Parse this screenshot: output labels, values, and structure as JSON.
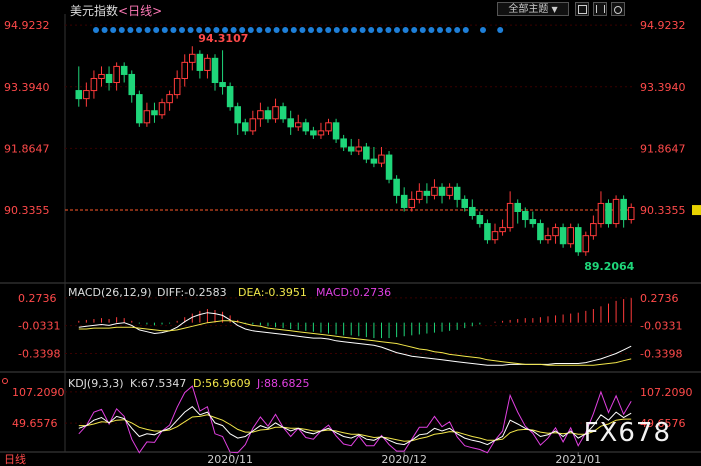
{
  "header": {
    "symbol": "美元指数",
    "period": "<日线>",
    "theme_button": "全部主题",
    "theme_arrow": "▼"
  },
  "colors": {
    "up": "#ff3b3b",
    "down": "#1fd67a",
    "price_axis": "#ff4a4a",
    "grid": "#3a0000",
    "diff_line": "#ffffff",
    "dea_line": "#f2e64a",
    "macd_label": "#e040e0",
    "kdj_k": "#ffffff",
    "kdj_d": "#f2e64a",
    "kdj_j": "#e040e0",
    "dots": "#1e7fd8"
  },
  "chart_data": {
    "type": "candlestick",
    "price_axis": {
      "ticks": [
        "94.9232",
        "93.3940",
        "91.8647",
        "90.3355"
      ],
      "values": [
        94.9232,
        93.394,
        91.8647,
        90.3355
      ]
    },
    "ylim": [
      88.6,
      95.2
    ],
    "current_price": 90.3355,
    "high_annotation": "94.3107",
    "low_annotation": "89.2064",
    "x_labels": [
      "2020/11",
      "2020/12",
      "2021/01"
    ],
    "candles": [
      [
        93.3,
        93.1,
        93.9,
        92.9
      ],
      [
        93.1,
        93.3,
        93.5,
        92.9
      ],
      [
        93.3,
        93.6,
        93.8,
        93.1
      ],
      [
        93.6,
        93.7,
        93.9,
        93.4
      ],
      [
        93.7,
        93.5,
        93.9,
        93.3
      ],
      [
        93.5,
        93.9,
        94.0,
        93.3
      ],
      [
        93.9,
        93.7,
        94.0,
        93.5
      ],
      [
        93.7,
        93.2,
        93.8,
        93.0
      ],
      [
        93.2,
        92.5,
        93.3,
        92.4
      ],
      [
        92.5,
        92.8,
        93.0,
        92.4
      ],
      [
        92.8,
        92.7,
        93.0,
        92.5
      ],
      [
        92.7,
        93.0,
        93.1,
        92.6
      ],
      [
        93.0,
        93.2,
        93.3,
        92.8
      ],
      [
        93.2,
        93.6,
        93.8,
        93.1
      ],
      [
        93.6,
        94.0,
        94.2,
        93.4
      ],
      [
        94.0,
        94.2,
        94.4,
        93.8
      ],
      [
        94.2,
        93.8,
        94.3,
        93.6
      ],
      [
        93.8,
        94.1,
        94.2,
        93.6
      ],
      [
        94.1,
        93.5,
        94.2,
        93.3
      ],
      [
        93.5,
        93.4,
        94.3,
        93.2
      ],
      [
        93.4,
        92.9,
        93.5,
        92.8
      ],
      [
        92.9,
        92.5,
        93.0,
        92.2
      ],
      [
        92.5,
        92.3,
        92.6,
        92.2
      ],
      [
        92.3,
        92.6,
        92.8,
        92.2
      ],
      [
        92.6,
        92.8,
        93.0,
        92.4
      ],
      [
        92.8,
        92.6,
        92.9,
        92.5
      ],
      [
        92.6,
        92.9,
        93.1,
        92.5
      ],
      [
        92.9,
        92.6,
        93.0,
        92.5
      ],
      [
        92.6,
        92.4,
        92.8,
        92.2
      ],
      [
        92.4,
        92.5,
        92.7,
        92.3
      ],
      [
        92.5,
        92.3,
        92.6,
        92.2
      ],
      [
        92.3,
        92.2,
        92.4,
        92.1
      ],
      [
        92.2,
        92.3,
        92.5,
        92.1
      ],
      [
        92.3,
        92.5,
        92.6,
        92.2
      ],
      [
        92.5,
        92.1,
        92.6,
        92.0
      ],
      [
        92.1,
        91.9,
        92.2,
        91.8
      ],
      [
        91.9,
        91.8,
        92.1,
        91.7
      ],
      [
        91.8,
        91.9,
        92.1,
        91.7
      ],
      [
        91.9,
        91.6,
        92.0,
        91.5
      ],
      [
        91.6,
        91.5,
        91.9,
        91.4
      ],
      [
        91.5,
        91.7,
        91.9,
        91.4
      ],
      [
        91.7,
        91.1,
        91.8,
        91.0
      ],
      [
        91.1,
        90.7,
        91.2,
        90.5
      ],
      [
        90.7,
        90.4,
        90.9,
        90.3
      ],
      [
        90.4,
        90.6,
        90.8,
        90.3
      ],
      [
        90.6,
        90.8,
        91.0,
        90.5
      ],
      [
        90.8,
        90.7,
        91.0,
        90.5
      ],
      [
        90.7,
        90.9,
        91.1,
        90.6
      ],
      [
        90.9,
        90.7,
        91.0,
        90.5
      ],
      [
        90.7,
        90.9,
        91.0,
        90.6
      ],
      [
        90.9,
        90.6,
        91.0,
        90.4
      ],
      [
        90.6,
        90.4,
        90.7,
        90.3
      ],
      [
        90.4,
        90.2,
        90.6,
        90.1
      ],
      [
        90.2,
        90.0,
        90.3,
        89.9
      ],
      [
        90.0,
        89.6,
        90.1,
        89.5
      ],
      [
        89.6,
        89.8,
        90.0,
        89.5
      ],
      [
        89.8,
        89.9,
        90.1,
        89.7
      ],
      [
        89.9,
        90.5,
        90.8,
        89.8
      ],
      [
        90.5,
        90.3,
        90.6,
        90.0
      ],
      [
        90.3,
        90.1,
        90.4,
        89.9
      ],
      [
        90.1,
        90.0,
        90.3,
        89.9
      ],
      [
        90.0,
        89.6,
        90.1,
        89.5
      ],
      [
        89.6,
        89.7,
        89.9,
        89.5
      ],
      [
        89.7,
        89.9,
        90.0,
        89.5
      ],
      [
        89.9,
        89.5,
        90.0,
        89.4
      ],
      [
        89.5,
        89.9,
        90.0,
        89.4
      ],
      [
        89.9,
        89.3,
        90.0,
        89.2
      ],
      [
        89.3,
        89.7,
        89.8,
        89.2
      ],
      [
        89.7,
        90.0,
        90.2,
        89.6
      ],
      [
        90.0,
        90.5,
        90.8,
        89.9
      ],
      [
        90.5,
        90.0,
        90.6,
        89.9
      ],
      [
        90.0,
        90.6,
        90.7,
        89.9
      ],
      [
        90.6,
        90.1,
        90.7,
        89.9
      ],
      [
        90.1,
        90.4,
        90.5,
        90.0
      ]
    ],
    "macd": {
      "label": "MACD(26,12,9)",
      "diff_label": "DIFF:-0.2583",
      "dea_label": "DEA:-0.3951",
      "macd_label": "MACD:0.2736",
      "ticks": [
        "0.2736",
        "-0.0331",
        "-0.3398"
      ],
      "ylim": [
        -0.5,
        0.36
      ],
      "histogram": [
        0.02,
        0.03,
        0.04,
        0.05,
        0.04,
        0.06,
        0.05,
        0.02,
        -0.01,
        -0.02,
        -0.03,
        -0.02,
        -0.01,
        0.02,
        0.06,
        0.1,
        0.13,
        0.15,
        0.14,
        0.12,
        0.08,
        0.03,
        -0.01,
        -0.02,
        -0.03,
        -0.04,
        -0.05,
        -0.06,
        -0.07,
        -0.08,
        -0.09,
        -0.1,
        -0.11,
        -0.12,
        -0.13,
        -0.14,
        -0.14,
        -0.15,
        -0.16,
        -0.17,
        -0.17,
        -0.17,
        -0.16,
        -0.15,
        -0.14,
        -0.13,
        -0.12,
        -0.11,
        -0.1,
        -0.09,
        -0.08,
        -0.06,
        -0.04,
        -0.02,
        0.0,
        0.01,
        0.02,
        0.03,
        0.04,
        0.05,
        0.05,
        0.06,
        0.07,
        0.08,
        0.09,
        0.1,
        0.11,
        0.13,
        0.15,
        0.18,
        0.21,
        0.24,
        0.26,
        0.27
      ],
      "diff": [
        -0.05,
        -0.04,
        -0.03,
        -0.02,
        -0.03,
        -0.01,
        0.0,
        -0.03,
        -0.08,
        -0.1,
        -0.12,
        -0.11,
        -0.09,
        -0.05,
        0.01,
        0.06,
        0.09,
        0.11,
        0.1,
        0.08,
        0.03,
        -0.03,
        -0.07,
        -0.09,
        -0.1,
        -0.11,
        -0.12,
        -0.13,
        -0.14,
        -0.15,
        -0.16,
        -0.17,
        -0.17,
        -0.18,
        -0.2,
        -0.21,
        -0.22,
        -0.23,
        -0.24,
        -0.25,
        -0.27,
        -0.3,
        -0.33,
        -0.35,
        -0.37,
        -0.38,
        -0.39,
        -0.4,
        -0.41,
        -0.42,
        -0.43,
        -0.44,
        -0.45,
        -0.46,
        -0.47,
        -0.47,
        -0.47,
        -0.46,
        -0.46,
        -0.46,
        -0.46,
        -0.46,
        -0.46,
        -0.45,
        -0.45,
        -0.45,
        -0.45,
        -0.44,
        -0.42,
        -0.4,
        -0.37,
        -0.34,
        -0.3,
        -0.26
      ],
      "dea": [
        -0.07,
        -0.07,
        -0.06,
        -0.06,
        -0.06,
        -0.05,
        -0.05,
        -0.05,
        -0.06,
        -0.07,
        -0.08,
        -0.09,
        -0.09,
        -0.08,
        -0.06,
        -0.04,
        -0.02,
        0.0,
        0.01,
        0.02,
        0.02,
        0.01,
        -0.01,
        -0.03,
        -0.04,
        -0.06,
        -0.07,
        -0.08,
        -0.09,
        -0.1,
        -0.11,
        -0.12,
        -0.13,
        -0.14,
        -0.15,
        -0.16,
        -0.17,
        -0.18,
        -0.19,
        -0.2,
        -0.21,
        -0.22,
        -0.23,
        -0.25,
        -0.27,
        -0.29,
        -0.3,
        -0.32,
        -0.33,
        -0.35,
        -0.36,
        -0.37,
        -0.38,
        -0.39,
        -0.41,
        -0.42,
        -0.43,
        -0.44,
        -0.45,
        -0.46,
        -0.46,
        -0.46,
        -0.47,
        -0.47,
        -0.47,
        -0.47,
        -0.47,
        -0.47,
        -0.47,
        -0.46,
        -0.45,
        -0.44,
        -0.42,
        -0.4
      ]
    },
    "kdj": {
      "label": "KDJ(9,3,3)",
      "k_label": "K:67.5347",
      "d_label": "D:56.9609",
      "j_label": "J:88.6825",
      "ticks": [
        "107.2090",
        "49.6576"
      ],
      "ylim": [
        0,
        120
      ],
      "k": [
        40,
        45,
        55,
        60,
        50,
        62,
        58,
        40,
        25,
        30,
        28,
        35,
        40,
        55,
        70,
        80,
        65,
        70,
        50,
        45,
        30,
        22,
        25,
        35,
        45,
        40,
        50,
        42,
        35,
        40,
        33,
        30,
        35,
        40,
        32,
        25,
        22,
        28,
        20,
        18,
        25,
        18,
        12,
        10,
        18,
        28,
        30,
        40,
        35,
        40,
        30,
        22,
        18,
        15,
        10,
        18,
        25,
        55,
        48,
        40,
        35,
        25,
        28,
        35,
        25,
        35,
        22,
        30,
        45,
        65,
        55,
        70,
        60,
        68
      ],
      "d": [
        45,
        45,
        48,
        52,
        51,
        55,
        56,
        50,
        42,
        38,
        35,
        35,
        37,
        43,
        52,
        61,
        62,
        65,
        60,
        55,
        47,
        38,
        33,
        33,
        37,
        38,
        42,
        42,
        40,
        40,
        38,
        35,
        35,
        37,
        35,
        32,
        29,
        29,
        26,
        23,
        24,
        22,
        19,
        16,
        17,
        21,
        24,
        29,
        31,
        34,
        33,
        29,
        25,
        22,
        18,
        18,
        20,
        32,
        37,
        38,
        37,
        33,
        31,
        32,
        30,
        32,
        29,
        29,
        34,
        44,
        48,
        55,
        57,
        57
      ],
      "j": [
        30,
        45,
        70,
        75,
        48,
        76,
        62,
        20,
        -5,
        15,
        14,
        35,
        46,
        79,
        106,
        118,
        72,
        80,
        30,
        25,
        -4,
        -10,
        10,
        40,
        61,
        44,
        66,
        42,
        25,
        40,
        23,
        20,
        35,
        46,
        26,
        11,
        8,
        26,
        8,
        8,
        27,
        10,
        -2,
        -2,
        20,
        42,
        42,
        62,
        43,
        52,
        24,
        8,
        4,
        1,
        -6,
        18,
        35,
        101,
        70,
        44,
        31,
        9,
        22,
        41,
        15,
        41,
        8,
        32,
        67,
        107,
        69,
        100,
        66,
        90
      ]
    }
  }
}
